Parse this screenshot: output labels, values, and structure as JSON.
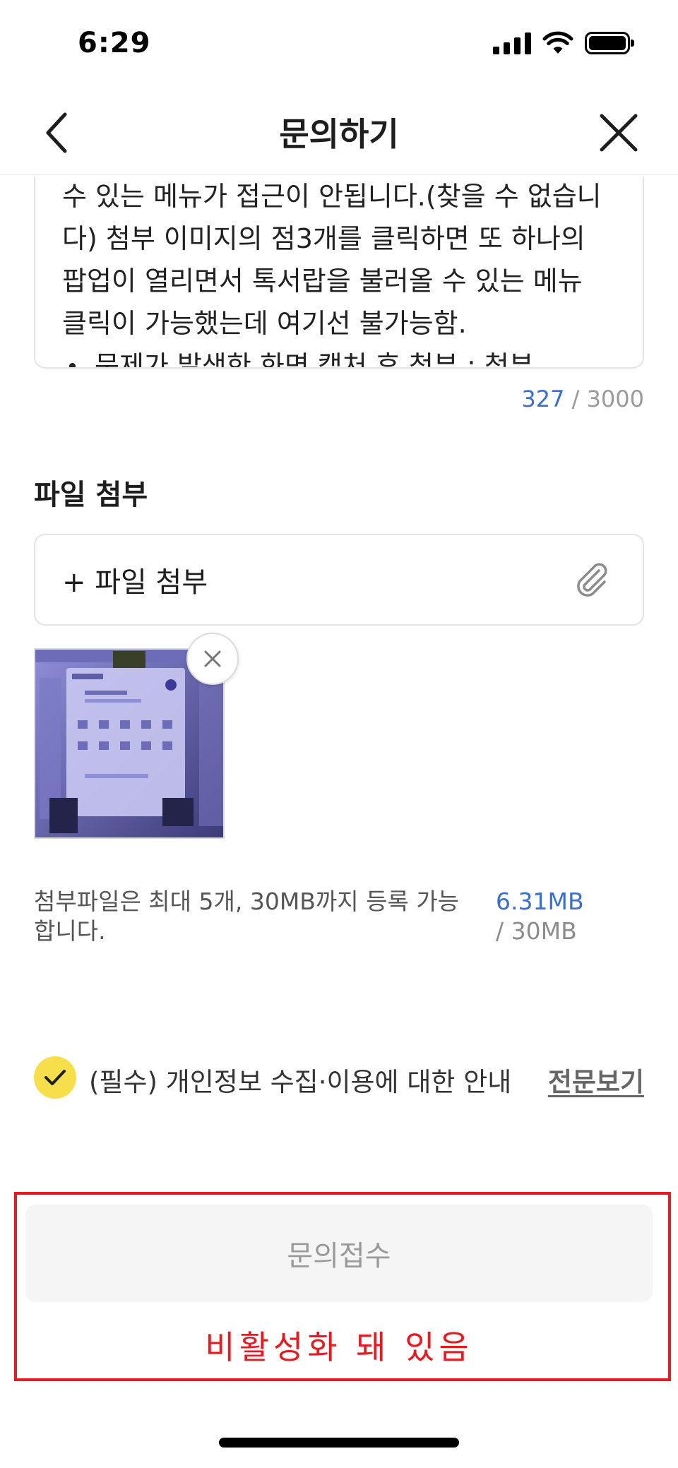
{
  "status_bar": {
    "time": "6:29",
    "icons": [
      "signal-icon",
      "wifi-icon",
      "battery-icon"
    ]
  },
  "nav": {
    "title": "문의하기",
    "back_icon": "chevron-left-icon",
    "close_icon": "close-icon"
  },
  "inquiry": {
    "visible_lines": [
      "수 있는 메뉴가 접근이 안됩니다.(찾을 수 없습니",
      "다) 첨부 이미지의 점3개를 클릭하면 또 하나의",
      "팝업이 열리면서 톡서랍을 불러올 수 있는 메뉴",
      "클릭이 가능했는데 여기선 불가능함."
    ],
    "partial_bullet": "문제가 발생한 화면 캡처 후 첨부 : 첨부",
    "char_count": "327",
    "char_separator": "/",
    "char_max": "3000"
  },
  "attachment": {
    "section_title": "파일 첨부",
    "add_label": "+ 파일 첨부",
    "add_icon": "paperclip-icon",
    "remove_icon": "close-icon",
    "limit_note": "첨부파일은 최대 5개, 30MB까지 등록 가능합니다.",
    "used_size": "6.31MB",
    "total_size": "/ 30MB"
  },
  "consent": {
    "checked": true,
    "label": "(필수) 개인정보 수집·이용에 대한 안내",
    "link_label": "전문보기"
  },
  "submit": {
    "label": "문의접수",
    "enabled": false
  },
  "annotation": {
    "text": "비활성화 돼 있음",
    "color": "#e8191f"
  },
  "colors": {
    "accent_blue": "#3a6fd1",
    "check_yellow": "#f7df4b",
    "annotation_red": "#e8191f"
  }
}
